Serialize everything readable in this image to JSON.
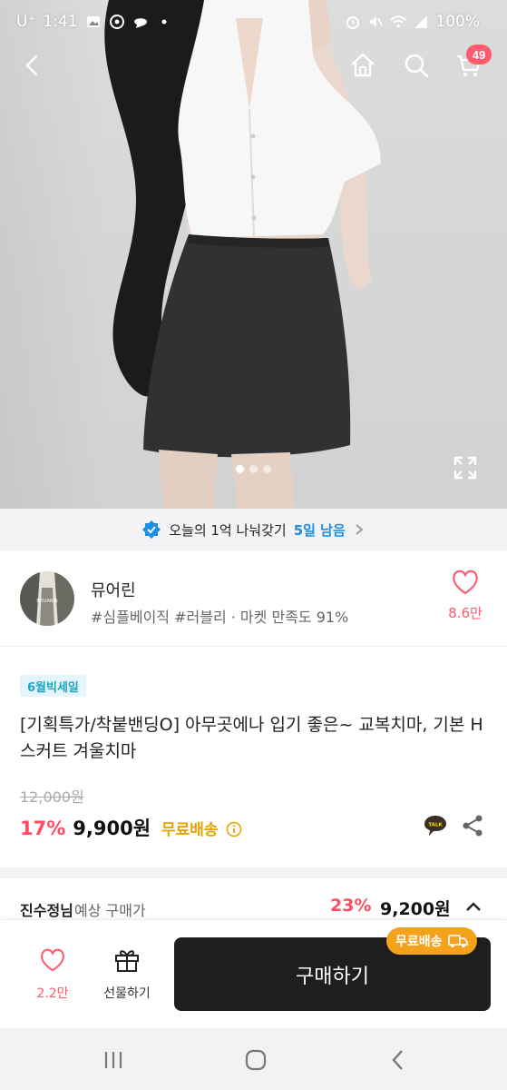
{
  "status_bar": {
    "carrier": "U⁺",
    "time": "1:41",
    "battery": "100%"
  },
  "nav": {
    "cart_count": "49"
  },
  "promo": {
    "text": "오늘의 1억 나눠갖기",
    "highlight": "5일 남음"
  },
  "shop": {
    "name": "뮤어린",
    "tags": "#심플베이직 #러블리 · 마켓 만족도 91%",
    "like_count": "8.6만",
    "avatar_text": "MYUARIN"
  },
  "product": {
    "badge": "6월빅세일",
    "title": "[기획특가/착붙밴딩O] 아무곳에나 입기 좋은~ 교복치마, 기본 H 스커트 겨울치마",
    "original_price": "12,000원",
    "discount": "17%",
    "price": "9,900원",
    "shipping": "무료배송",
    "talk_label": "TALK"
  },
  "expected": {
    "user_name": "진수정님",
    "label": "예상 구매가",
    "discount": "23%",
    "price": "9,200원"
  },
  "action_bar": {
    "like_count": "2.2만",
    "gift_label": "선물하기",
    "buy_label": "구매하기",
    "free_tag": "무료배송"
  },
  "colors": {
    "accent_pink": "#ff5a6e",
    "discount_red": "#ff4d5f",
    "ship_yellow": "#e8a400",
    "promo_blue": "#1a8fe3"
  }
}
